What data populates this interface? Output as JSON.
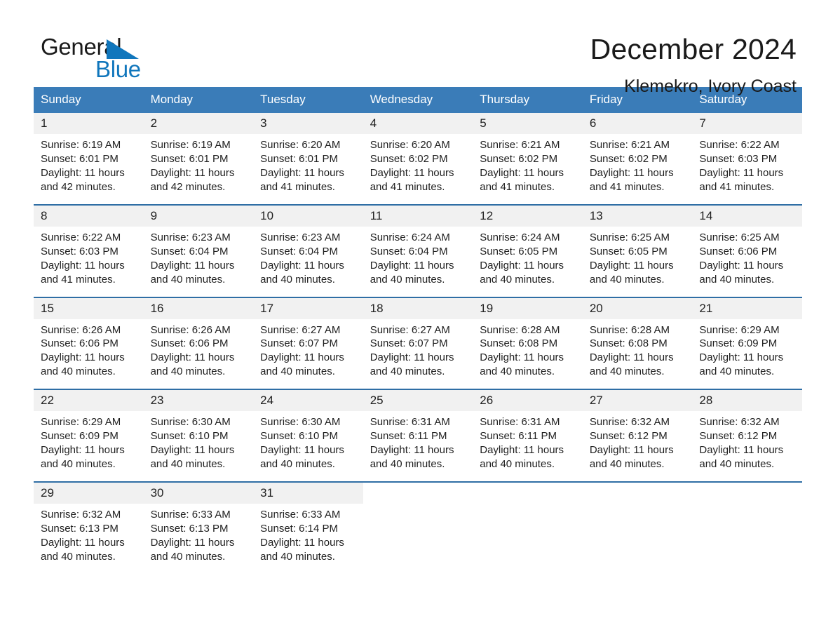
{
  "brand": {
    "name_part1": "General",
    "name_part2": "Blue",
    "flag_icon": "triangle-flag-icon",
    "accent_color": "#1076bc"
  },
  "header": {
    "month_title": "December 2024",
    "location": "Klemekro, Ivory Coast"
  },
  "theme": {
    "header_bg": "#3a7cb8",
    "week_divider": "#2f6ea5",
    "daynum_bg": "#f1f1f1",
    "text": "#1f1f1f"
  },
  "weekday_headers": [
    "Sunday",
    "Monday",
    "Tuesday",
    "Wednesday",
    "Thursday",
    "Friday",
    "Saturday"
  ],
  "weeks": [
    {
      "days": [
        {
          "num": "1",
          "sunrise": "Sunrise: 6:19 AM",
          "sunset": "Sunset: 6:01 PM",
          "daylight_l1": "Daylight: 11 hours",
          "daylight_l2": "and 42 minutes."
        },
        {
          "num": "2",
          "sunrise": "Sunrise: 6:19 AM",
          "sunset": "Sunset: 6:01 PM",
          "daylight_l1": "Daylight: 11 hours",
          "daylight_l2": "and 42 minutes."
        },
        {
          "num": "3",
          "sunrise": "Sunrise: 6:20 AM",
          "sunset": "Sunset: 6:01 PM",
          "daylight_l1": "Daylight: 11 hours",
          "daylight_l2": "and 41 minutes."
        },
        {
          "num": "4",
          "sunrise": "Sunrise: 6:20 AM",
          "sunset": "Sunset: 6:02 PM",
          "daylight_l1": "Daylight: 11 hours",
          "daylight_l2": "and 41 minutes."
        },
        {
          "num": "5",
          "sunrise": "Sunrise: 6:21 AM",
          "sunset": "Sunset: 6:02 PM",
          "daylight_l1": "Daylight: 11 hours",
          "daylight_l2": "and 41 minutes."
        },
        {
          "num": "6",
          "sunrise": "Sunrise: 6:21 AM",
          "sunset": "Sunset: 6:02 PM",
          "daylight_l1": "Daylight: 11 hours",
          "daylight_l2": "and 41 minutes."
        },
        {
          "num": "7",
          "sunrise": "Sunrise: 6:22 AM",
          "sunset": "Sunset: 6:03 PM",
          "daylight_l1": "Daylight: 11 hours",
          "daylight_l2": "and 41 minutes."
        }
      ]
    },
    {
      "days": [
        {
          "num": "8",
          "sunrise": "Sunrise: 6:22 AM",
          "sunset": "Sunset: 6:03 PM",
          "daylight_l1": "Daylight: 11 hours",
          "daylight_l2": "and 41 minutes."
        },
        {
          "num": "9",
          "sunrise": "Sunrise: 6:23 AM",
          "sunset": "Sunset: 6:04 PM",
          "daylight_l1": "Daylight: 11 hours",
          "daylight_l2": "and 40 minutes."
        },
        {
          "num": "10",
          "sunrise": "Sunrise: 6:23 AM",
          "sunset": "Sunset: 6:04 PM",
          "daylight_l1": "Daylight: 11 hours",
          "daylight_l2": "and 40 minutes."
        },
        {
          "num": "11",
          "sunrise": "Sunrise: 6:24 AM",
          "sunset": "Sunset: 6:04 PM",
          "daylight_l1": "Daylight: 11 hours",
          "daylight_l2": "and 40 minutes."
        },
        {
          "num": "12",
          "sunrise": "Sunrise: 6:24 AM",
          "sunset": "Sunset: 6:05 PM",
          "daylight_l1": "Daylight: 11 hours",
          "daylight_l2": "and 40 minutes."
        },
        {
          "num": "13",
          "sunrise": "Sunrise: 6:25 AM",
          "sunset": "Sunset: 6:05 PM",
          "daylight_l1": "Daylight: 11 hours",
          "daylight_l2": "and 40 minutes."
        },
        {
          "num": "14",
          "sunrise": "Sunrise: 6:25 AM",
          "sunset": "Sunset: 6:06 PM",
          "daylight_l1": "Daylight: 11 hours",
          "daylight_l2": "and 40 minutes."
        }
      ]
    },
    {
      "days": [
        {
          "num": "15",
          "sunrise": "Sunrise: 6:26 AM",
          "sunset": "Sunset: 6:06 PM",
          "daylight_l1": "Daylight: 11 hours",
          "daylight_l2": "and 40 minutes."
        },
        {
          "num": "16",
          "sunrise": "Sunrise: 6:26 AM",
          "sunset": "Sunset: 6:06 PM",
          "daylight_l1": "Daylight: 11 hours",
          "daylight_l2": "and 40 minutes."
        },
        {
          "num": "17",
          "sunrise": "Sunrise: 6:27 AM",
          "sunset": "Sunset: 6:07 PM",
          "daylight_l1": "Daylight: 11 hours",
          "daylight_l2": "and 40 minutes."
        },
        {
          "num": "18",
          "sunrise": "Sunrise: 6:27 AM",
          "sunset": "Sunset: 6:07 PM",
          "daylight_l1": "Daylight: 11 hours",
          "daylight_l2": "and 40 minutes."
        },
        {
          "num": "19",
          "sunrise": "Sunrise: 6:28 AM",
          "sunset": "Sunset: 6:08 PM",
          "daylight_l1": "Daylight: 11 hours",
          "daylight_l2": "and 40 minutes."
        },
        {
          "num": "20",
          "sunrise": "Sunrise: 6:28 AM",
          "sunset": "Sunset: 6:08 PM",
          "daylight_l1": "Daylight: 11 hours",
          "daylight_l2": "and 40 minutes."
        },
        {
          "num": "21",
          "sunrise": "Sunrise: 6:29 AM",
          "sunset": "Sunset: 6:09 PM",
          "daylight_l1": "Daylight: 11 hours",
          "daylight_l2": "and 40 minutes."
        }
      ]
    },
    {
      "days": [
        {
          "num": "22",
          "sunrise": "Sunrise: 6:29 AM",
          "sunset": "Sunset: 6:09 PM",
          "daylight_l1": "Daylight: 11 hours",
          "daylight_l2": "and 40 minutes."
        },
        {
          "num": "23",
          "sunrise": "Sunrise: 6:30 AM",
          "sunset": "Sunset: 6:10 PM",
          "daylight_l1": "Daylight: 11 hours",
          "daylight_l2": "and 40 minutes."
        },
        {
          "num": "24",
          "sunrise": "Sunrise: 6:30 AM",
          "sunset": "Sunset: 6:10 PM",
          "daylight_l1": "Daylight: 11 hours",
          "daylight_l2": "and 40 minutes."
        },
        {
          "num": "25",
          "sunrise": "Sunrise: 6:31 AM",
          "sunset": "Sunset: 6:11 PM",
          "daylight_l1": "Daylight: 11 hours",
          "daylight_l2": "and 40 minutes."
        },
        {
          "num": "26",
          "sunrise": "Sunrise: 6:31 AM",
          "sunset": "Sunset: 6:11 PM",
          "daylight_l1": "Daylight: 11 hours",
          "daylight_l2": "and 40 minutes."
        },
        {
          "num": "27",
          "sunrise": "Sunrise: 6:32 AM",
          "sunset": "Sunset: 6:12 PM",
          "daylight_l1": "Daylight: 11 hours",
          "daylight_l2": "and 40 minutes."
        },
        {
          "num": "28",
          "sunrise": "Sunrise: 6:32 AM",
          "sunset": "Sunset: 6:12 PM",
          "daylight_l1": "Daylight: 11 hours",
          "daylight_l2": "and 40 minutes."
        }
      ]
    },
    {
      "days": [
        {
          "num": "29",
          "sunrise": "Sunrise: 6:32 AM",
          "sunset": "Sunset: 6:13 PM",
          "daylight_l1": "Daylight: 11 hours",
          "daylight_l2": "and 40 minutes."
        },
        {
          "num": "30",
          "sunrise": "Sunrise: 6:33 AM",
          "sunset": "Sunset: 6:13 PM",
          "daylight_l1": "Daylight: 11 hours",
          "daylight_l2": "and 40 minutes."
        },
        {
          "num": "31",
          "sunrise": "Sunrise: 6:33 AM",
          "sunset": "Sunset: 6:14 PM",
          "daylight_l1": "Daylight: 11 hours",
          "daylight_l2": "and 40 minutes."
        },
        {
          "num": "",
          "sunrise": "",
          "sunset": "",
          "daylight_l1": "",
          "daylight_l2": ""
        },
        {
          "num": "",
          "sunrise": "",
          "sunset": "",
          "daylight_l1": "",
          "daylight_l2": ""
        },
        {
          "num": "",
          "sunrise": "",
          "sunset": "",
          "daylight_l1": "",
          "daylight_l2": ""
        },
        {
          "num": "",
          "sunrise": "",
          "sunset": "",
          "daylight_l1": "",
          "daylight_l2": ""
        }
      ]
    }
  ]
}
